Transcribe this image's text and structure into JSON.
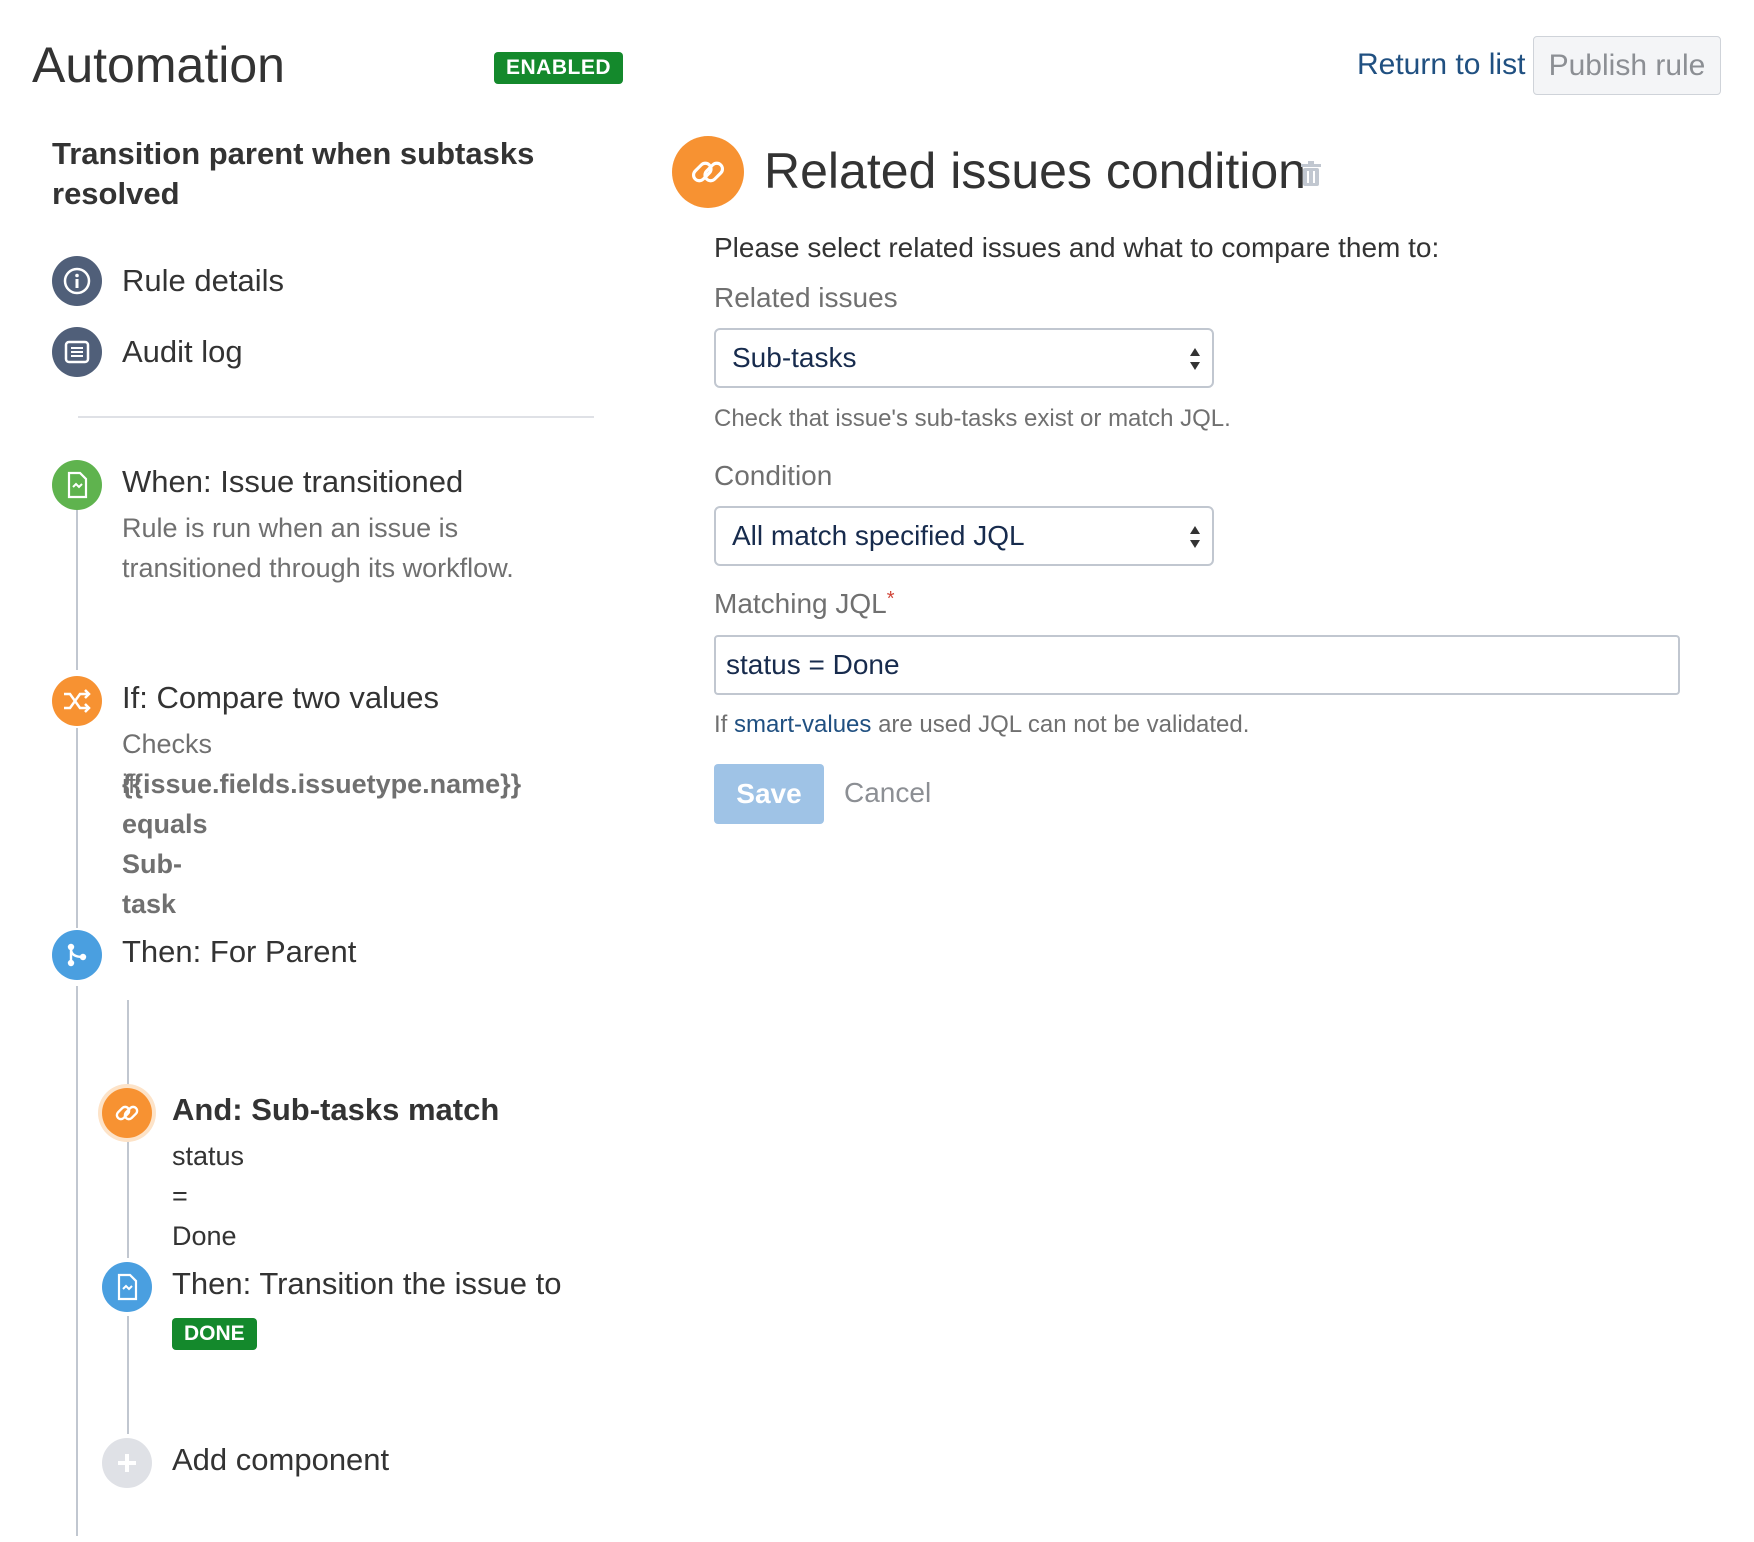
{
  "header": {
    "title": "Automation",
    "status_badge": "ENABLED",
    "return_link": "Return to list",
    "publish_button": "Publish rule"
  },
  "sidebar": {
    "rule_name": "Transition parent when subtasks resolved",
    "nav": [
      {
        "label": "Rule details",
        "icon": "info-icon"
      },
      {
        "label": "Audit log",
        "icon": "list-icon"
      }
    ],
    "steps": {
      "trigger": {
        "title": "When: Issue transitioned",
        "desc": "Rule is run when an issue is transitioned through its workflow.",
        "icon": "issue-transition-icon"
      },
      "condition": {
        "title": "If: Compare two values",
        "desc_prefix": "Checks if:",
        "desc_value": "{{issue.fields.issuetype.name}}",
        "desc_compare": "equals Sub-task",
        "icon": "shuffle-icon"
      },
      "branch": {
        "title": "Then: For Parent",
        "icon": "branch-icon"
      },
      "related": {
        "title": "And: Sub-tasks match",
        "desc": "status = Done",
        "icon": "link-icon"
      },
      "action": {
        "title": "Then: Transition the issue to",
        "badge": "DONE",
        "icon": "issue-transition-icon"
      },
      "add": {
        "title": "Add component",
        "icon": "plus-icon"
      }
    }
  },
  "panel": {
    "title": "Related issues condition",
    "instructions": "Please select related issues and what to compare them to:",
    "related_label": "Related issues",
    "related_value": "Sub-tasks",
    "related_help": "Check that issue's sub-tasks exist or match JQL.",
    "condition_label": "Condition",
    "condition_value": "All match specified JQL",
    "jql_label": "Matching JQL",
    "jql_required": "*",
    "jql_value": "status = Done",
    "jql_help_prefix": "If",
    "jql_help_link": "smart-values",
    "jql_help_suffix": "are used JQL can not be validated.",
    "save": "Save",
    "cancel": "Cancel"
  },
  "colors": {
    "enabled_green": "#14892c",
    "link_blue": "#205081",
    "orange": "#f79232",
    "step_green": "#5fb34e",
    "step_blue": "#4a9fe0",
    "nav_slate": "#505f79"
  }
}
